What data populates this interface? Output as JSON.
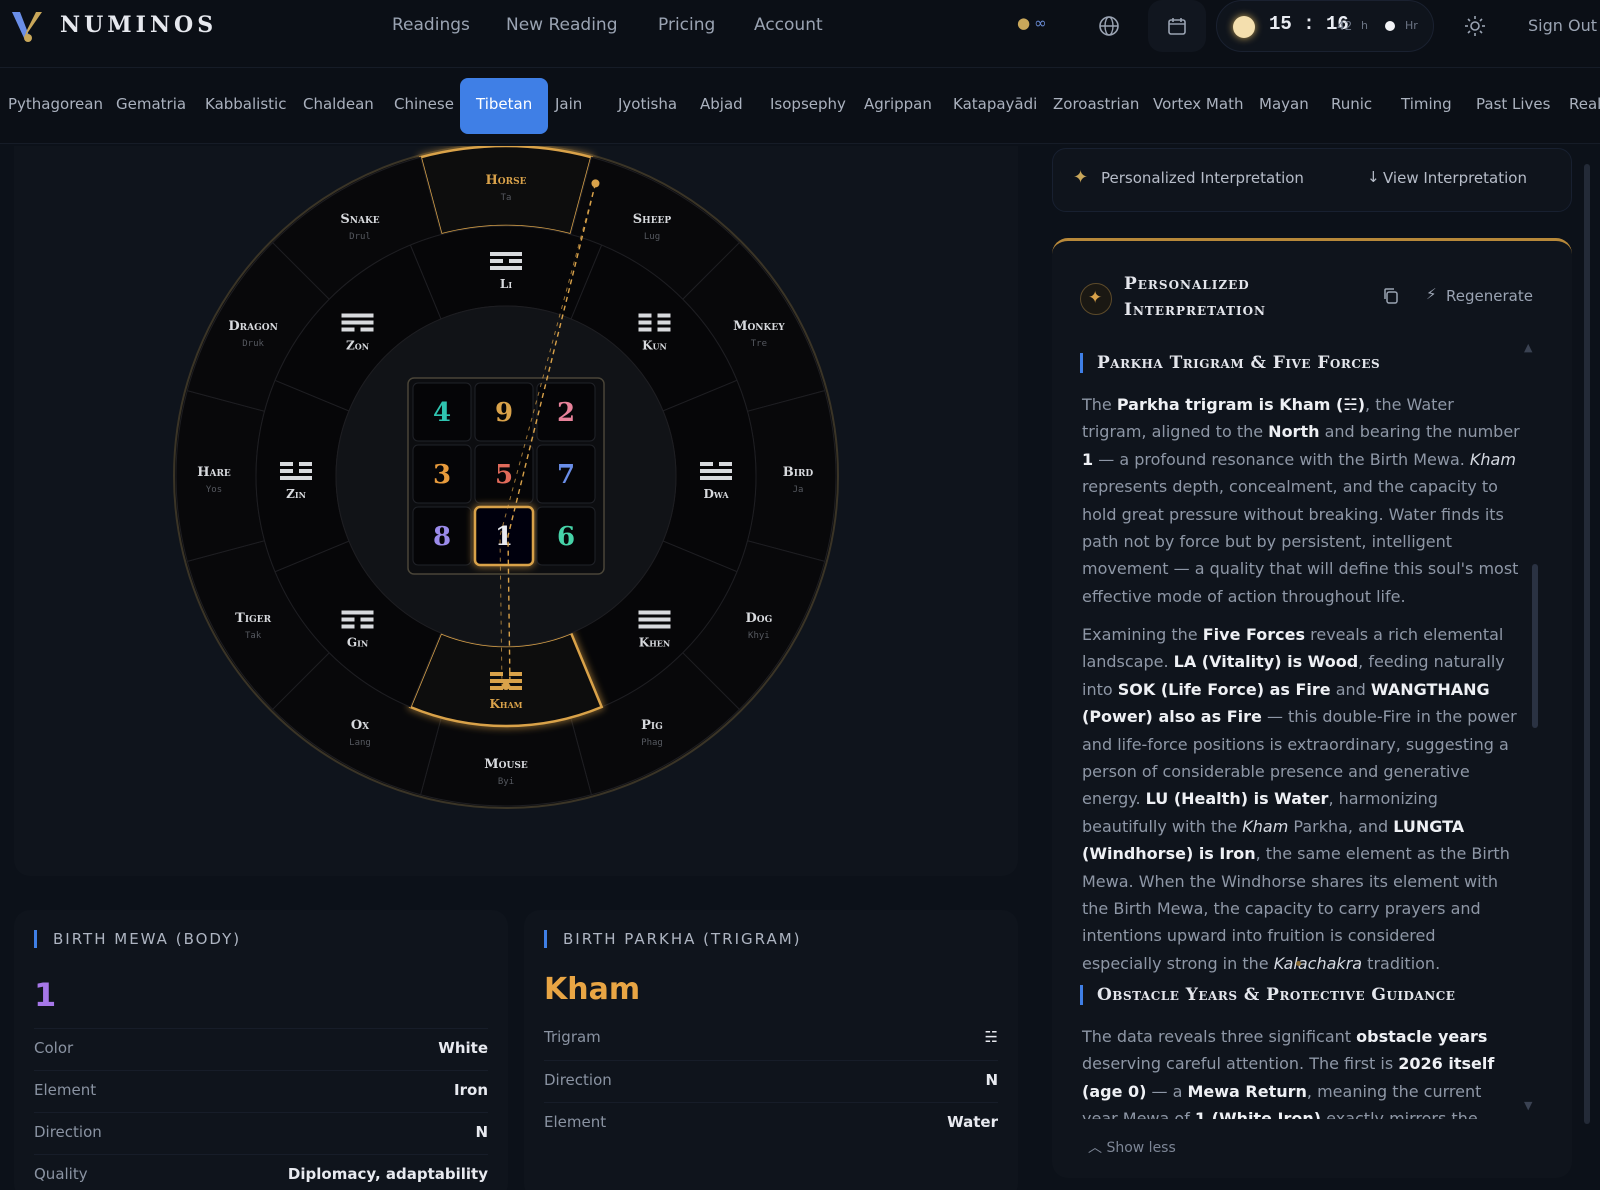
{
  "header": {
    "brand": "NUMINOS",
    "nav": [
      "Readings",
      "New Reading",
      "Pricing",
      "Account"
    ],
    "credits": "∞",
    "clock": {
      "time": "15 : 16",
      "seconds": "42",
      "unit": "h",
      "mode": "Hr"
    },
    "sign_out": "Sign Out"
  },
  "systems": {
    "tabs": [
      "Pythagorean",
      "Gematria",
      "Kabbalistic",
      "Chaldean",
      "Chinese",
      "Tibetan",
      "Jain",
      "Jyotisha",
      "Abjad",
      "Isopsephy",
      "Agrippan",
      "Katapayādi",
      "Zoroastrian",
      "Vortex Math",
      "Mayan",
      "Runic",
      "Timing",
      "Past Lives",
      "Real"
    ],
    "active": "Tibetan"
  },
  "wheel": {
    "animals": [
      {
        "name": "Horse",
        "tib": "Ta"
      },
      {
        "name": "Sheep",
        "tib": "Lug"
      },
      {
        "name": "Monkey",
        "tib": "Tre"
      },
      {
        "name": "Bird",
        "tib": "Ja"
      },
      {
        "name": "Dog",
        "tib": "Khyi"
      },
      {
        "name": "Pig",
        "tib": "Phag"
      },
      {
        "name": "Mouse",
        "tib": "Byi"
      },
      {
        "name": "Ox",
        "tib": "Lang"
      },
      {
        "name": "Tiger",
        "tib": "Tak"
      },
      {
        "name": "Hare",
        "tib": "Yos"
      },
      {
        "name": "Dragon",
        "tib": "Druk"
      },
      {
        "name": "Snake",
        "tib": "Drul"
      }
    ],
    "trigrams": [
      "Li",
      "Kun",
      "Dwa",
      "Khen",
      "Kham",
      "Gin",
      "Zin",
      "Zon"
    ],
    "highlight_animal": "Horse",
    "highlight_trigram": "Kham",
    "mewa_grid": [
      [
        4,
        9,
        2
      ],
      [
        3,
        5,
        7
      ],
      [
        8,
        1,
        6
      ]
    ],
    "mewa_highlight": 1,
    "colors": {
      "gold": "#d9a24a",
      "teal": "#2fc4b0",
      "pink": "#e8829a",
      "orange": "#e89b3c",
      "red": "#e06a5a",
      "blue": "#6a8ee8",
      "purple": "#9b8bea",
      "green": "#46d3a8",
      "white": "#e8eaf0"
    }
  },
  "interpretation": {
    "strip_label": "Personalized Interpretation",
    "view_label": "View Interpretation",
    "title": "Personalized Interpretation",
    "regenerate": "Regenerate",
    "section1_title": "Parkha Trigram & Five Forces",
    "section2_title": "Obstacle Years & Protective Guidance",
    "show_less": "Show less"
  },
  "birth_mewa": {
    "label": "BIRTH MEWA (BODY)",
    "number": "1",
    "rows": [
      {
        "k": "Color",
        "v": "White"
      },
      {
        "k": "Element",
        "v": "Iron"
      },
      {
        "k": "Direction",
        "v": "N"
      },
      {
        "k": "Quality",
        "v": "Diplomacy, adaptability"
      }
    ]
  },
  "birth_parkha": {
    "label": "BIRTH PARKHA (TRIGRAM)",
    "name": "Kham",
    "rows": [
      {
        "k": "Trigram",
        "v": "☵"
      },
      {
        "k": "Direction",
        "v": "N"
      },
      {
        "k": "Element",
        "v": "Water"
      }
    ]
  }
}
